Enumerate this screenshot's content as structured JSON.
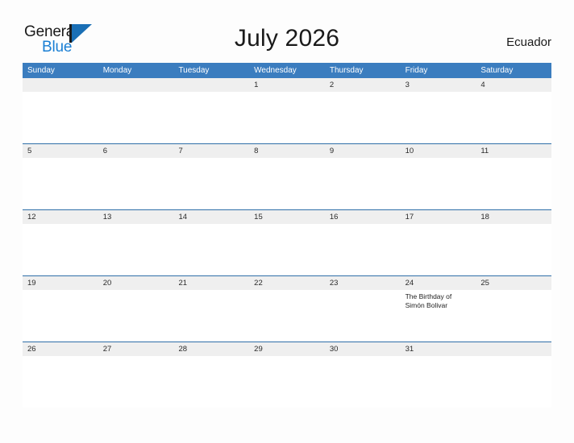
{
  "brand": {
    "name_part1": "General",
    "name_part2": "Blue",
    "flag_color": "#1a6fb5",
    "text_color": "#1a7fd4"
  },
  "header": {
    "title": "July 2026",
    "country": "Ecuador"
  },
  "theme": {
    "header_bar_color": "#3b7dbf",
    "row_divider_color": "#2f6fa8",
    "day_band_color": "#efefef",
    "page_background": "#fdfdfd"
  },
  "calendar": {
    "weekdays": [
      "Sunday",
      "Monday",
      "Tuesday",
      "Wednesday",
      "Thursday",
      "Friday",
      "Saturday"
    ],
    "weeks": [
      [
        {
          "day": "",
          "events": []
        },
        {
          "day": "",
          "events": []
        },
        {
          "day": "",
          "events": []
        },
        {
          "day": "1",
          "events": []
        },
        {
          "day": "2",
          "events": []
        },
        {
          "day": "3",
          "events": []
        },
        {
          "day": "4",
          "events": []
        }
      ],
      [
        {
          "day": "5",
          "events": []
        },
        {
          "day": "6",
          "events": []
        },
        {
          "day": "7",
          "events": []
        },
        {
          "day": "8",
          "events": []
        },
        {
          "day": "9",
          "events": []
        },
        {
          "day": "10",
          "events": []
        },
        {
          "day": "11",
          "events": []
        }
      ],
      [
        {
          "day": "12",
          "events": []
        },
        {
          "day": "13",
          "events": []
        },
        {
          "day": "14",
          "events": []
        },
        {
          "day": "15",
          "events": []
        },
        {
          "day": "16",
          "events": []
        },
        {
          "day": "17",
          "events": []
        },
        {
          "day": "18",
          "events": []
        }
      ],
      [
        {
          "day": "19",
          "events": []
        },
        {
          "day": "20",
          "events": []
        },
        {
          "day": "21",
          "events": []
        },
        {
          "day": "22",
          "events": []
        },
        {
          "day": "23",
          "events": []
        },
        {
          "day": "24",
          "events": [
            "The Birthday of Simón Bolivar"
          ]
        },
        {
          "day": "25",
          "events": []
        }
      ],
      [
        {
          "day": "26",
          "events": []
        },
        {
          "day": "27",
          "events": []
        },
        {
          "day": "28",
          "events": []
        },
        {
          "day": "29",
          "events": []
        },
        {
          "day": "30",
          "events": []
        },
        {
          "day": "31",
          "events": []
        },
        {
          "day": "",
          "events": []
        }
      ]
    ]
  }
}
